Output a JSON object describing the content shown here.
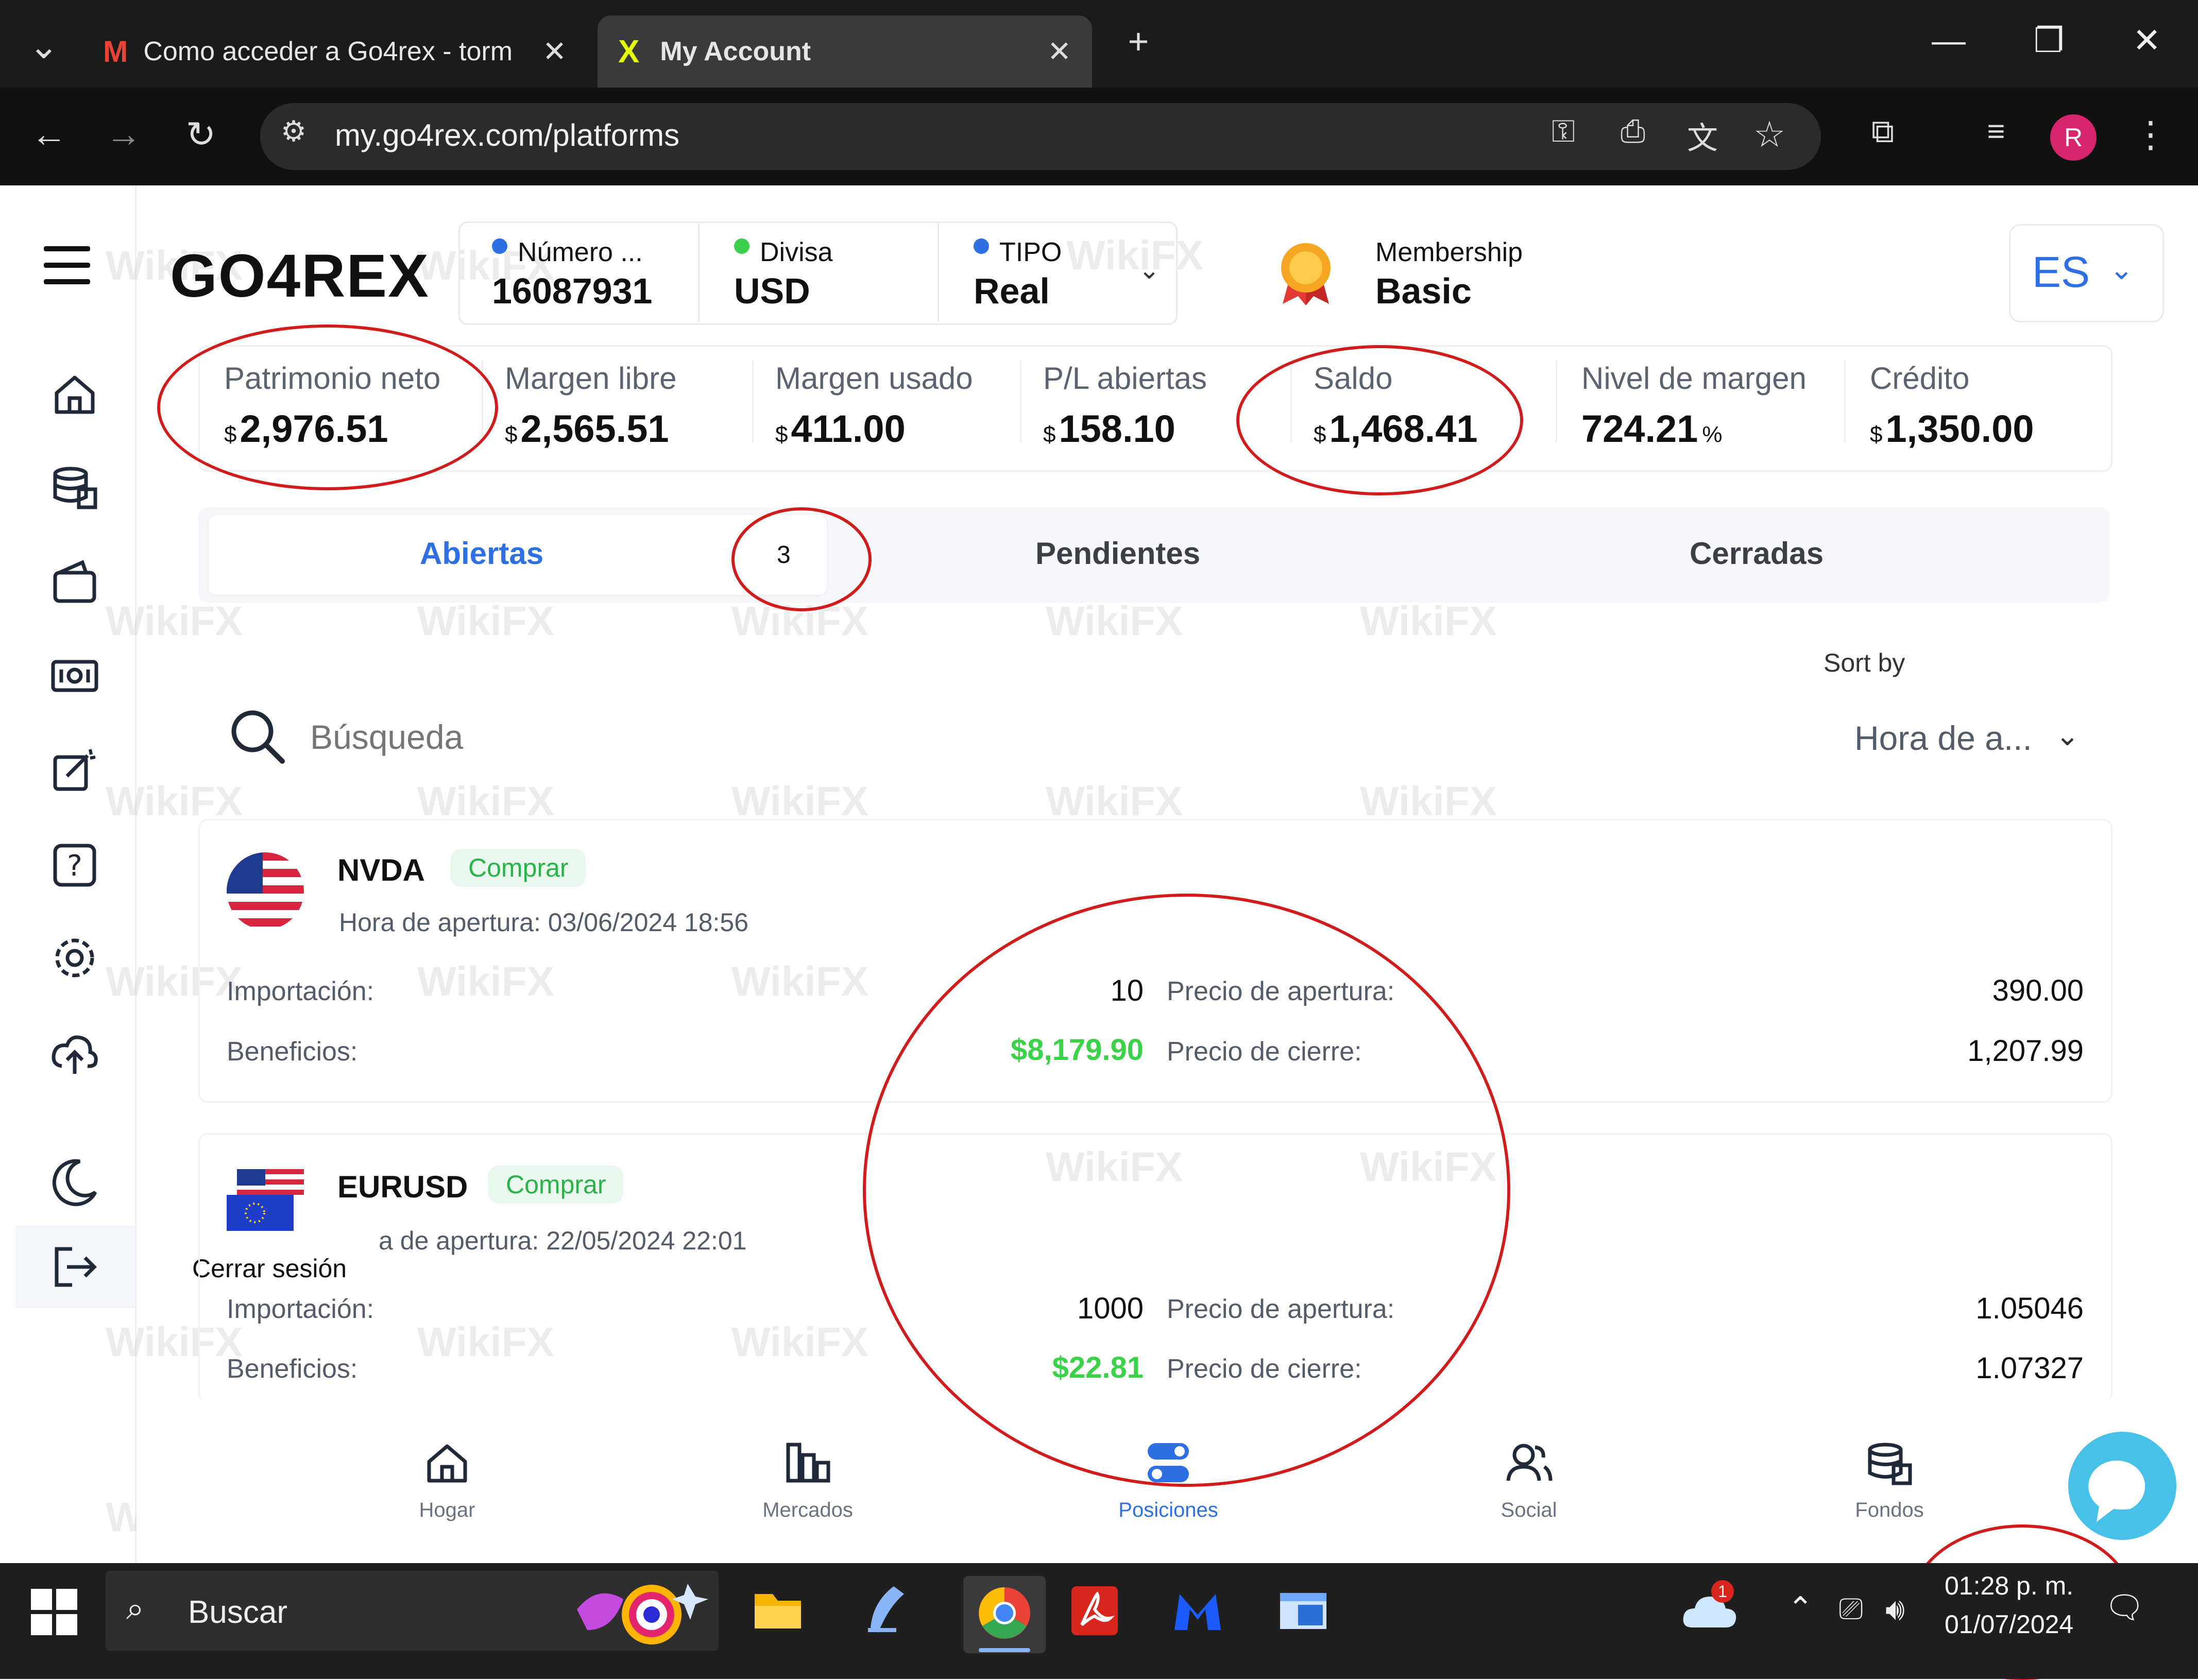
{
  "browser": {
    "tabs": [
      {
        "title": "Como acceder a Go4rex - torm",
        "icon": "gmail-icon"
      },
      {
        "title": "My Account",
        "icon": "go4rex-x-icon"
      }
    ],
    "url": "my.go4rex.com/platforms"
  },
  "header": {
    "logo": "GO4REX",
    "account": [
      {
        "label": "Número ...",
        "value": "16087931",
        "dot": "#2f6fe4"
      },
      {
        "label": "Divisa",
        "value": "USD",
        "dot": "#3ccf4e"
      },
      {
        "label": "TIPO",
        "value": "Real",
        "dot": "#2f6fe4"
      }
    ],
    "membership_label": "Membership",
    "membership_value": "Basic",
    "language": "ES"
  },
  "stats": [
    {
      "label": "Patrimonio neto",
      "prefix": "$",
      "value": "2,976.51",
      "suffix": ""
    },
    {
      "label": "Margen libre",
      "prefix": "$",
      "value": "2,565.51",
      "suffix": ""
    },
    {
      "label": "Margen usado",
      "prefix": "$",
      "value": "411.00",
      "suffix": ""
    },
    {
      "label": "P/L abiertas",
      "prefix": "$",
      "value": "158.10",
      "suffix": ""
    },
    {
      "label": "Saldo",
      "prefix": "$",
      "value": "1,468.41",
      "suffix": ""
    },
    {
      "label": "Nivel de margen",
      "prefix": "",
      "value": "724.21",
      "suffix": "%"
    },
    {
      "label": "Crédito",
      "prefix": "$",
      "value": "1,350.00",
      "suffix": ""
    }
  ],
  "tabs": {
    "open": "Abiertas",
    "open_count": "3",
    "pending": "Pendientes",
    "closed": "Cerradas"
  },
  "search": {
    "placeholder": "Búsqueda"
  },
  "sort": {
    "label": "Sort by",
    "value": "Hora de a..."
  },
  "positions": [
    {
      "symbol": "NVDA",
      "side": "Comprar",
      "open_time": "Hora de apertura: 03/06/2024 18:56",
      "qty_label": "Importación:",
      "qty": "10",
      "profit_label": "Beneficios:",
      "profit": "$8,179.90",
      "open_price_label": "Precio de apertura:",
      "open_price": "390.00",
      "close_price_label": "Precio de cierre:",
      "close_price": "1,207.99"
    },
    {
      "symbol": "EURUSD",
      "side": "Comprar",
      "open_time": "a de apertura: 22/05/2024 22:01",
      "qty_label": "Importación:",
      "qty": "1000",
      "profit_label": "Beneficios:",
      "profit": "$22.81",
      "open_price_label": "Precio de apertura:",
      "open_price": "1.05046",
      "close_price_label": "Precio de cierre:",
      "close_price": "1.07327"
    }
  ],
  "logout_tooltip": "Cerrar sesión",
  "bottom_nav": [
    "Hogar",
    "Mercados",
    "Posiciones",
    "Social",
    "Fondos"
  ],
  "watermark": "WikiFX",
  "taskbar": {
    "search": "Buscar",
    "time": "01:28 p. m.",
    "date": "01/07/2024",
    "notif": "1",
    "avatar": "R"
  },
  "colors": {
    "accent": "#2f6fe4",
    "profit": "#3bd24a",
    "annotation": "#d01c1c"
  }
}
